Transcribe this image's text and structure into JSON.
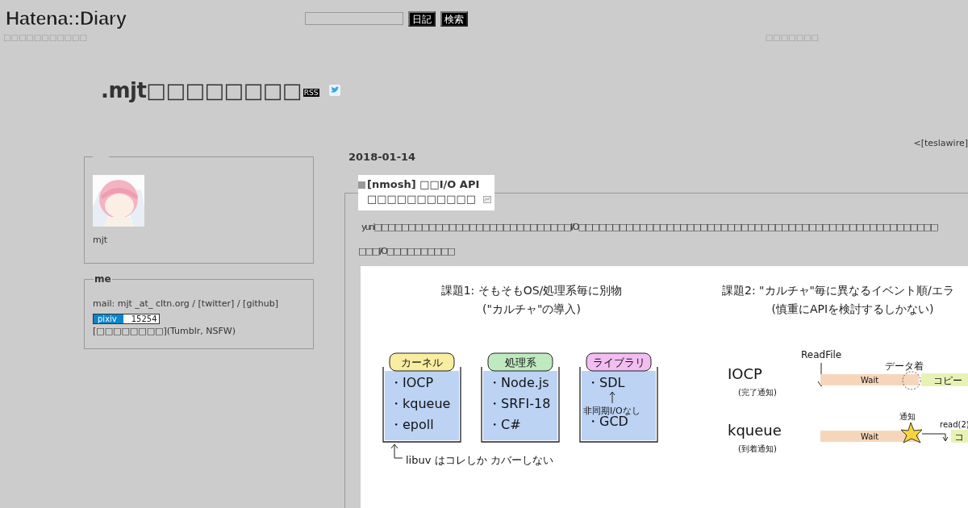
{
  "header": {
    "logo": "Hatena::Diary",
    "buttons": [
      "日記",
      "検索"
    ],
    "tagline": "□□□□□□□□□□□",
    "right_link": "□□□□□□□"
  },
  "blog": {
    "title": ".mjt□□□□□□□□",
    "rss": "RSS"
  },
  "nav": {
    "prev_link": "<[teslawire]"
  },
  "profile": {
    "name": "mjt"
  },
  "me": {
    "heading": "me",
    "mail_line": {
      "text": "mail: mjt _at_ cltn.org / ",
      "links": [
        "[twitter]",
        "[github]"
      ],
      "separator": " / "
    },
    "pixiv": {
      "label": "pixiv",
      "count": "15254"
    },
    "tumblr_line": {
      "link": "[□□□□□□□□]",
      "text": "(Tumblr, NSFW)"
    }
  },
  "entry": {
    "date": "2018-01-14",
    "title": "[nmosh] □□I/O API□□□□□□□□□□□",
    "paragraphs": [
      "yuni□□□□□□□□□□□□□□□□□□□□□□□□□□□□□I/O□□□□□□□□□□□□□□□□□□□□□□□□□□□□□□□□□□□□□□□□□□□□□□□□□□□□□",
      "□□□I/O□□□□□□□□□□"
    ],
    "figure": {
      "challenge1": {
        "title": "課題1: そもそもOS/処理系毎に別物",
        "subtitle": "(\"カルチャ\"の導入)",
        "groups": [
          {
            "label": "カーネル",
            "color": "#f8eda0",
            "items": [
              "・IOCP",
              "・kqueue",
              "・epoll"
            ]
          },
          {
            "label": "処理系",
            "color": "#bfeac0",
            "items": [
              "・Node.js",
              "・SRFI-18",
              "・C#"
            ]
          },
          {
            "label": "ライブラリ",
            "color": "#f2bdf0",
            "items": [
              "・SDL",
              "・GCD"
            ],
            "remark": "非同期I/Oなし"
          }
        ],
        "note": "libuv はコレしか カバーしない"
      },
      "challenge2": {
        "title": "課題2: \"カルチャ\"毎に異なるイベント順/エラ",
        "subtitle": "(慎重にAPIを検討するしかない)",
        "call": "ReadFile",
        "rows": [
          {
            "kind": "completion",
            "name": "IOCP",
            "sub": "(完了通知)",
            "wait": "Wait",
            "event": "データ着",
            "copy": "コピー"
          },
          {
            "kind": "readiness",
            "name": "kqueue",
            "sub": "(到着通知)",
            "wait": "Wait",
            "event": "通知",
            "call": "read(2)",
            "copy": "コ"
          }
        ]
      }
    }
  }
}
